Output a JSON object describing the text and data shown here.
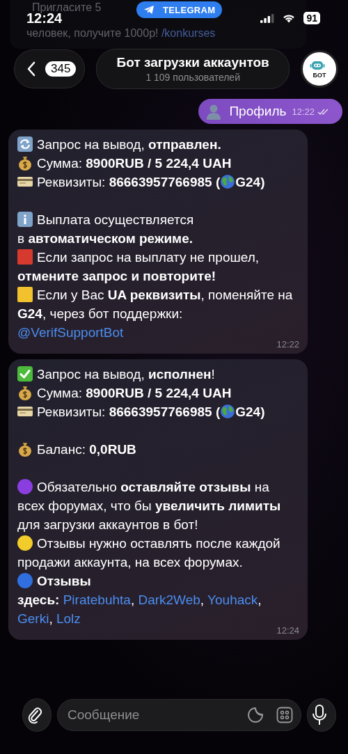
{
  "status_bar": {
    "time": "12:24",
    "app_pill": "TELEGRAM",
    "battery": "91"
  },
  "background_message": {
    "lines": [
      [
        {
          "kind": "text",
          "text": "Пригласите 5"
        }
      ],
      [
        {
          "kind": "text",
          "text": "человек, получите 1000р! "
        },
        {
          "kind": "link",
          "text": "/konkurses"
        }
      ]
    ]
  },
  "header": {
    "back_count": "345",
    "title": "Бот загрузки аккаунтов",
    "subtitle": "1 109 пользователей",
    "avatar_text": "БОТ"
  },
  "messages": [
    {
      "kind": "outgoing",
      "text": "Профиль",
      "time": "12:22",
      "read": true
    },
    {
      "kind": "incoming",
      "time": "12:22",
      "blocks": [
        [
          {
            "kind": "refresh",
            "parts": [
              {
                "kind": "text",
                "text": "Запрос на вывод, **отправлен.**"
              }
            ]
          },
          {
            "kind": "money",
            "parts": [
              {
                "kind": "text",
                "text": "Сумма: **8900RUB  / 5 224,4 UAH**"
              }
            ]
          },
          {
            "kind": "card",
            "parts": [
              {
                "kind": "text",
                "text": "Реквизиты: **86663957766985 (**"
              },
              {
                "kind": "icon"
              },
              {
                "kind": "text",
                "text": "**G24)**"
              }
            ]
          }
        ],
        [
          {
            "kind": "info",
            "parts": [
              {
                "kind": "text",
                "text": "Выплата осуществляется"
              }
            ]
          },
          {
            "kind": "plain",
            "parts": [
              {
                "kind": "text",
                "text": "в **автоматическом режиме.**"
              }
            ]
          },
          {
            "kind": "square",
            "color": "#d63a2f",
            "parts": [
              {
                "kind": "text",
                "text": "Если запрос на выплату не прошел, **отмените запрос и повторите!**"
              }
            ]
          },
          {
            "kind": "square",
            "color": "#f2c12e",
            "parts": [
              {
                "kind": "text",
                "text": "Если у Вас **UA реквизиты**, поменяйте на **G24**, через бот поддержки:"
              }
            ]
          },
          {
            "kind": "plain",
            "parts": [
              {
                "kind": "link",
                "text": "@VerifSupportBot"
              }
            ]
          }
        ]
      ]
    },
    {
      "kind": "incoming",
      "time": "12:24",
      "blocks": [
        [
          {
            "kind": "check",
            "parts": [
              {
                "kind": "text",
                "text": "Запрос на вывод, **исполнен**!"
              }
            ]
          },
          {
            "kind": "money",
            "parts": [
              {
                "kind": "text",
                "text": "Сумма: **8900RUB  / 5 224,4 UAH**"
              }
            ]
          },
          {
            "kind": "card",
            "parts": [
              {
                "kind": "text",
                "text": "Реквизиты: **86663957766985 (**"
              },
              {
                "kind": "icon"
              },
              {
                "kind": "text",
                "text": "**G24)**"
              }
            ]
          }
        ],
        [
          {
            "kind": "money",
            "parts": [
              {
                "kind": "text",
                "text": "Баланс: **0,0RUB**"
              }
            ]
          }
        ],
        [
          {
            "kind": "dot",
            "color": "#8b3ee0",
            "parts": [
              {
                "kind": "text",
                "text": "Обязательно **оставляйте отзывы** на всех форумах, что бы **увеличить лимиты** для загрузки аккаунтов в бот!"
              }
            ]
          },
          {
            "kind": "dot",
            "color": "#f2cc2a",
            "parts": [
              {
                "kind": "text",
                "text": "Отзывы нужно оставлять после каждой продажи аккаунта, на всех форумах."
              }
            ]
          },
          {
            "kind": "dot",
            "color": "#2f6fe0",
            "parts": [
              {
                "kind": "text",
                "text": "**Отзывы**"
              }
            ]
          },
          {
            "kind": "plain",
            "parts": [
              {
                "kind": "text",
                "text": "**здесь:** "
              },
              {
                "kind": "link",
                "text": "Piratebuhta"
              },
              {
                "kind": "text",
                "text": ", "
              },
              {
                "kind": "link",
                "text": "Dark2Web"
              },
              {
                "kind": "text",
                "text": ", "
              },
              {
                "kind": "link",
                "text": "Youhack"
              },
              {
                "kind": "text",
                "text": ", "
              },
              {
                "kind": "link",
                "text": "Gerki"
              },
              {
                "kind": "text",
                "text": ", "
              },
              {
                "kind": "link",
                "text": "Lolz"
              }
            ]
          }
        ]
      ]
    }
  ],
  "composer": {
    "placeholder": "Сообщение"
  }
}
